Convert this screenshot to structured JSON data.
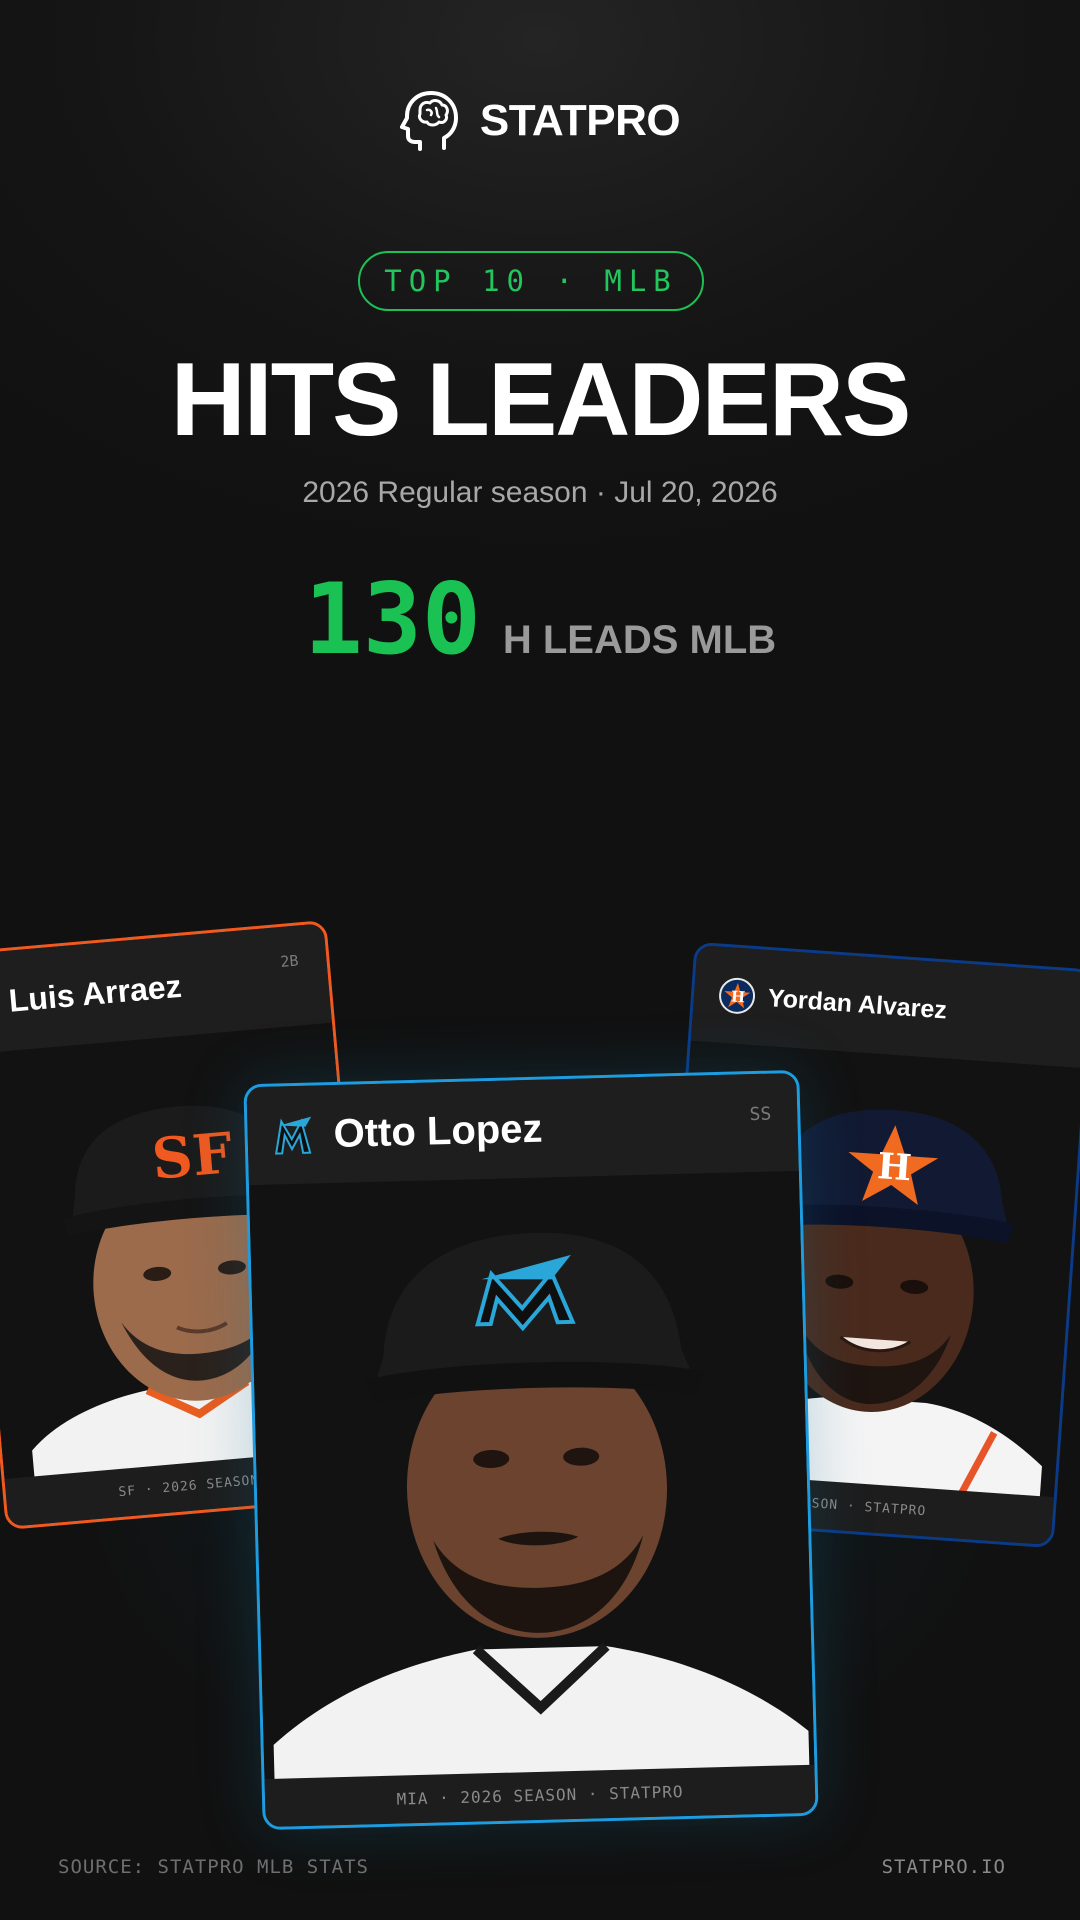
{
  "brand": {
    "name": "STATPRO",
    "icon": "brain-head-icon"
  },
  "badge": "TOP 10 · MLB",
  "title": "HITS LEADERS",
  "subtitle": "2026 Regular season · Jul 20, 2026",
  "lead_stat": {
    "value": "130",
    "label": "H LEADS MLB"
  },
  "colors": {
    "accent": "#22c55e",
    "giants": "#f05a20",
    "marlins": "#1d9ce0",
    "astros": "#0b3b86"
  },
  "cards": {
    "left": {
      "name": "Luis Arraez",
      "position": "2B",
      "footer": "SF · 2026 SEASON",
      "team_icon": "giants-sf-logo-icon"
    },
    "center": {
      "name": "Otto Lopez",
      "position": "SS",
      "footer": "MIA · 2026 SEASON · STATPRO",
      "team_icon": "marlins-m-logo-icon"
    },
    "right": {
      "name": "Yordan Alvarez",
      "footer": "SEASON · STATPRO",
      "team_icon": "astros-h-logo-icon"
    }
  },
  "footer": {
    "source": "SOURCE: STATPRO MLB STATS",
    "site": "STATPRO.IO"
  }
}
